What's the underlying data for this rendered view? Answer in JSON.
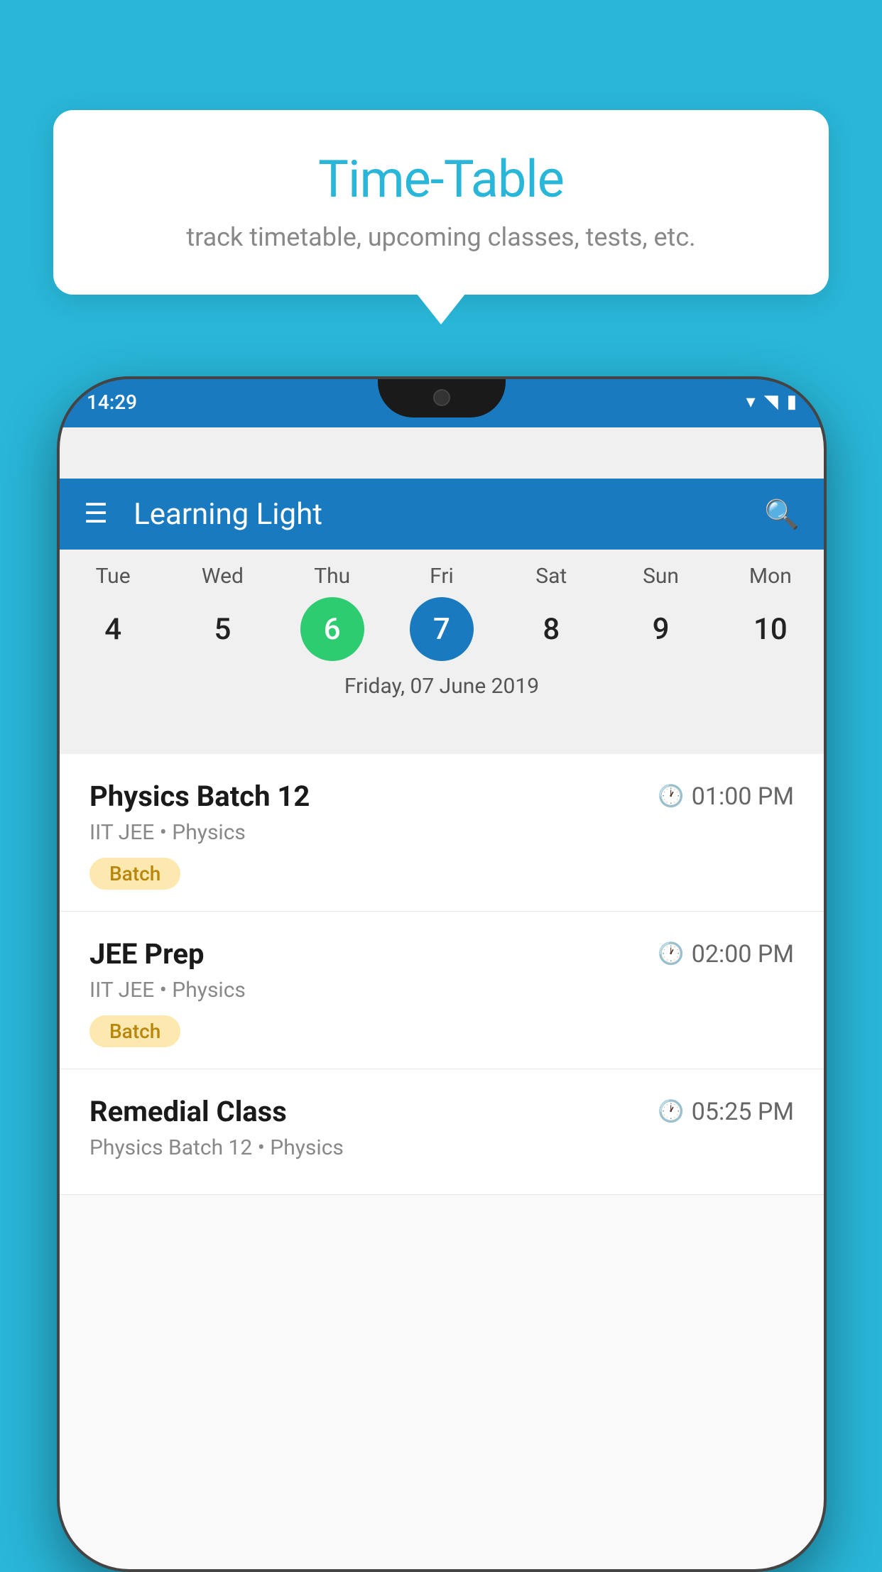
{
  "background_color": "#29b6d8",
  "bubble": {
    "title": "Time-Table",
    "subtitle": "track timetable, upcoming classes, tests, etc."
  },
  "phone": {
    "status_bar": {
      "time": "14:29"
    },
    "app_bar": {
      "title": "Learning Light"
    },
    "calendar": {
      "days": [
        "Tue",
        "Wed",
        "Thu",
        "Fri",
        "Sat",
        "Sun",
        "Mon"
      ],
      "dates": [
        "4",
        "5",
        "6",
        "7",
        "8",
        "9",
        "10"
      ],
      "today_index": 2,
      "selected_index": 3,
      "selected_label": "Friday, 07 June 2019"
    },
    "schedule": [
      {
        "name": "Physics Batch 12",
        "time": "01:00 PM",
        "subtitle": "IIT JEE • Physics",
        "badge": "Batch"
      },
      {
        "name": "JEE Prep",
        "time": "02:00 PM",
        "subtitle": "IIT JEE • Physics",
        "badge": "Batch"
      },
      {
        "name": "Remedial Class",
        "time": "05:25 PM",
        "subtitle": "Physics Batch 12 • Physics",
        "badge": null
      }
    ]
  }
}
